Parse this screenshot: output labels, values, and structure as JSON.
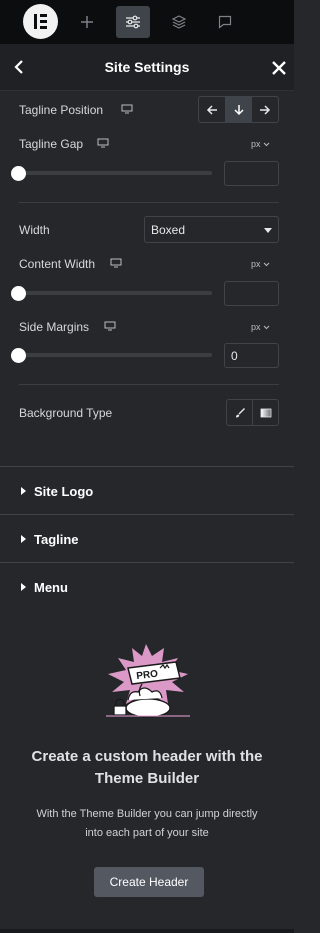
{
  "header": {
    "title": "Site Settings"
  },
  "topbar": {
    "icons": [
      "elementor-logo",
      "add-icon",
      "settings-sliders-icon",
      "layers-icon",
      "comments-icon"
    ]
  },
  "controls": {
    "tagline_position": {
      "label": "Tagline Position",
      "options": [
        "arrow-left-icon",
        "arrow-down-icon",
        "arrow-right-icon"
      ],
      "selected": "arrow-down-icon"
    },
    "tagline_gap": {
      "label": "Tagline Gap",
      "unit": "px",
      "value": "",
      "slider": 0
    },
    "width": {
      "label": "Width",
      "value": "Boxed"
    },
    "content_width": {
      "label": "Content Width",
      "unit": "px",
      "value": "",
      "slider": 0
    },
    "side_margins": {
      "label": "Side Margins",
      "unit": "px",
      "value": "0",
      "slider": 0
    },
    "background_type": {
      "label": "Background Type",
      "options": [
        "brush-icon",
        "gradient-icon"
      ]
    }
  },
  "sections": [
    {
      "label": "Site Logo"
    },
    {
      "label": "Tagline"
    },
    {
      "label": "Menu"
    }
  ],
  "promo": {
    "badge": "PRO",
    "title": "Create a custom header with the Theme Builder",
    "description": "With the Theme Builder you can jump directly into each part of your site",
    "button": "Create Header"
  },
  "colors": {
    "panel_bg": "#26272b",
    "topbar_bg": "#0c0d0e",
    "accent_pink": "#f0a6d8",
    "button_bg": "#545861"
  }
}
